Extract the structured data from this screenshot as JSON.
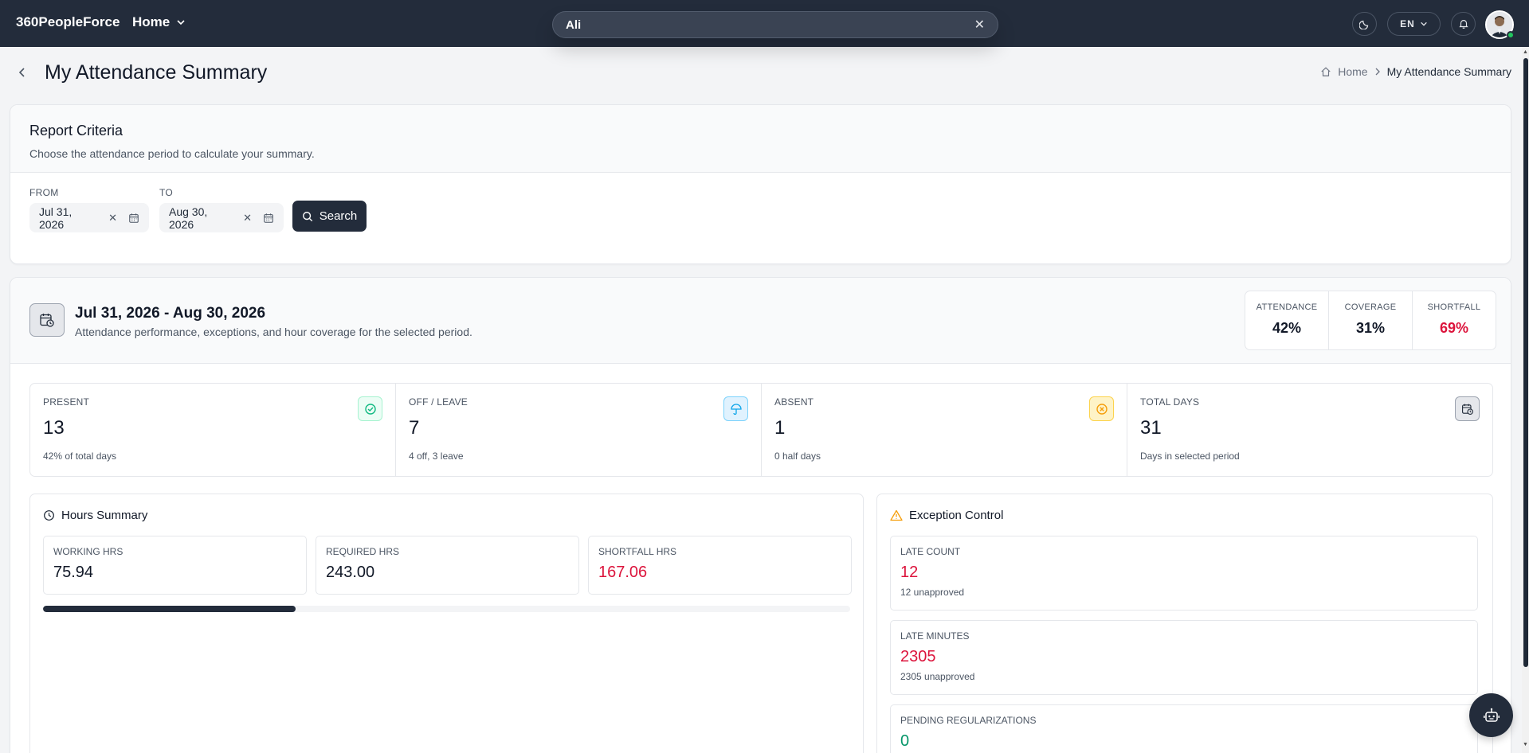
{
  "topbar": {
    "brand": "360PeopleForce",
    "home_label": "Home",
    "search_value": "Ali",
    "lang_label": "EN"
  },
  "page": {
    "title": "My Attendance Summary",
    "breadcrumb": {
      "home": "Home",
      "current": "My Attendance Summary"
    }
  },
  "criteria": {
    "title": "Report Criteria",
    "subtitle": "Choose the attendance period to calculate your summary.",
    "from_label": "FROM",
    "from_value": "Jul 31, 2026",
    "to_label": "TO",
    "to_value": "Aug 30, 2026",
    "search_label": "Search"
  },
  "summary": {
    "period_title": "Jul 31, 2026 - Aug 30, 2026",
    "period_subtitle": "Attendance performance, exceptions, and hour coverage for the selected period.",
    "kpis": [
      {
        "label": "ATTENDANCE",
        "value": "42%"
      },
      {
        "label": "COVERAGE",
        "value": "31%"
      },
      {
        "label": "SHORTFALL",
        "value": "69%"
      }
    ],
    "stats": [
      {
        "label": "PRESENT",
        "value": "13",
        "sub": "42% of total days",
        "icon": "check-circle-icon",
        "color": "#10b981",
        "bg": "#ecfdf5"
      },
      {
        "label": "OFF / LEAVE",
        "value": "7",
        "sub": "4 off, 3 leave",
        "icon": "umbrella-icon",
        "color": "#0ea5e9",
        "bg": "#e0f2fe"
      },
      {
        "label": "ABSENT",
        "value": "1",
        "sub": "0 half days",
        "icon": "x-circle-icon",
        "color": "#f59e0b",
        "bg": "#fef3c7"
      },
      {
        "label": "TOTAL DAYS",
        "value": "31",
        "sub": "Days in selected period",
        "icon": "calendar-clock-icon",
        "color": "#1f2937",
        "bg": "#e5e7eb"
      }
    ]
  },
  "hours": {
    "title": "Hours Summary",
    "items": [
      {
        "label": "WORKING HRS",
        "value": "75.94"
      },
      {
        "label": "REQUIRED HRS",
        "value": "243.00"
      },
      {
        "label": "SHORTFALL HRS",
        "value": "167.06"
      }
    ],
    "progress_fraction": 0.3125
  },
  "exceptions": {
    "title": "Exception Control",
    "items": [
      {
        "label": "LATE COUNT",
        "value": "12",
        "sub": "12 unapproved"
      },
      {
        "label": "LATE MINUTES",
        "value": "2305",
        "sub": "2305 unapproved"
      },
      {
        "label": "PENDING REGULARIZATIONS",
        "value": "0",
        "sub": ""
      }
    ]
  },
  "colors": {
    "navy": "#232c3b",
    "danger": "#dc143c",
    "success": "#059669",
    "warning": "#f59e0b"
  }
}
